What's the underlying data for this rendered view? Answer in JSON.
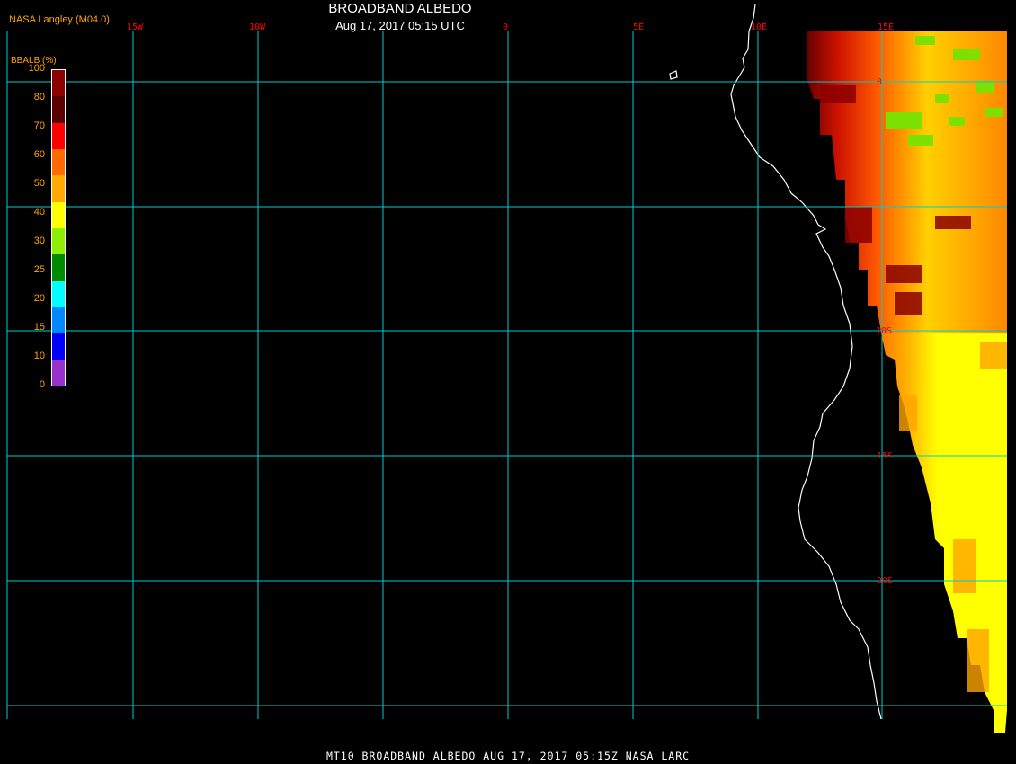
{
  "header": {
    "credit": "NASA Langley (M04.0)",
    "title": "BROADBAND ALBEDO",
    "subtitle": "Aug 17, 2017 05:15 UTC"
  },
  "footer": {
    "caption": "MT10  BROADBAND ALBEDO   AUG 17, 2017 05:15Z   NASA LARC"
  },
  "grid": {
    "lon_labels": [
      "15W",
      "10W",
      "0",
      "5E",
      "10E",
      "15E"
    ],
    "lat_labels": [
      "0",
      "10S",
      "15S",
      "20S"
    ]
  },
  "legend": {
    "title": "BBALB (%)",
    "ticks": [
      "100",
      "80",
      "70",
      "60",
      "50",
      "40",
      "30",
      "25",
      "20",
      "15",
      "10",
      "0"
    ],
    "colors": [
      "#8b0000",
      "#5a0000",
      "#ff0000",
      "#ff6a00",
      "#ffaa00",
      "#ffff00",
      "#90ee00",
      "#008a00",
      "#00ffff",
      "#0088ff",
      "#0000ff",
      "#9932cc"
    ]
  },
  "colors": {
    "gridline": "#00ced1",
    "label": "#ff0000",
    "coastline": "#ffffff",
    "accent": "#ffa500"
  }
}
